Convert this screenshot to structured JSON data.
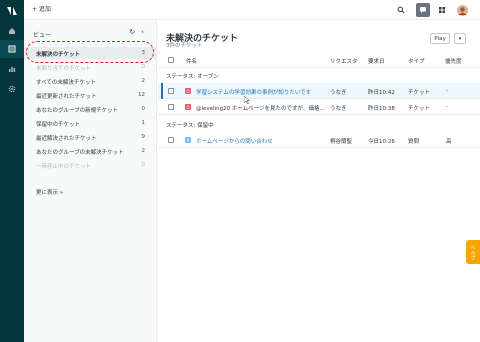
{
  "colors": {
    "rail": "#03363d",
    "accent_link": "#1f73b7",
    "highlight": "#d9231e",
    "status_open": "#e35b66",
    "status_pending": "#7fbde6",
    "help_tab": "#f7a600"
  },
  "topbar": {
    "add_label": "+ 追加",
    "icons": [
      "search-icon",
      "chat-icon",
      "apps-icon",
      "avatar"
    ]
  },
  "sidebar": {
    "title": "ビュー",
    "refresh_icon": "↻",
    "collapse_icon": "‹",
    "items": [
      {
        "label": "未解決のチケット",
        "count": "3"
      },
      {
        "label": "未割り当てのチケット",
        "count": "0"
      },
      {
        "label": "すべての未解決チケット",
        "count": "2"
      },
      {
        "label": "最近更新されたチケット",
        "count": "12"
      },
      {
        "label": "あなたのグループの新規チケット",
        "count": "0"
      },
      {
        "label": "保留中のチケット",
        "count": "1"
      },
      {
        "label": "最近解決されたチケット",
        "count": "9"
      },
      {
        "label": "あなたのグループの未解決チケット",
        "count": "2"
      },
      {
        "label": "一時停止中のチケット",
        "count": "0"
      }
    ],
    "more_link": "更に表示 »"
  },
  "main": {
    "title": "未解決のチケット",
    "subtitle": "3件のチケット",
    "play_label": "Play",
    "dropdown_icon": "▾",
    "columns": {
      "subject": "件名",
      "requester": "リクエスタ",
      "updated": "要求日",
      "type": "タイプ",
      "priority": "優先度"
    },
    "groups": [
      {
        "label": "ステータス: オープン",
        "rows": [
          {
            "status": "O",
            "subject": "学習システムの学習効果の事例が知りたいです",
            "requester": "うなぎ",
            "updated": "昨日10:42",
            "type": "チケット",
            "priority": "-"
          },
          {
            "status": "O",
            "subject": "@leveling20 ホームページを見たのですが、価格...",
            "requester": "うなぎ",
            "updated": "昨日10:38",
            "type": "チケット",
            "priority": "-"
          }
        ]
      },
      {
        "label": "ステータス: 保留中",
        "rows": [
          {
            "status": "P",
            "subject": "ホームページからの問い合わせ",
            "requester": "桐谷蘭聖",
            "updated": "今日10:26",
            "type": "質問",
            "priority": "高"
          }
        ]
      }
    ]
  },
  "help_tab_label": "ヘルプ"
}
